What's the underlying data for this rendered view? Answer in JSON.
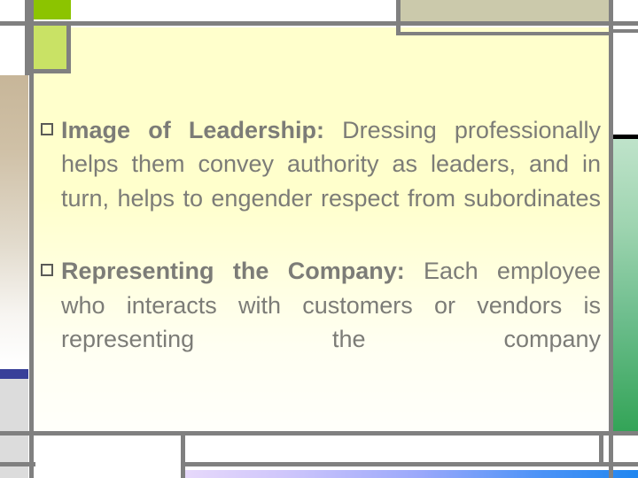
{
  "slide": {
    "background_color": "#ffffcc",
    "text_color": "#7c7c77",
    "accent_colors": {
      "green_tab": "#8cc400",
      "green_light": "#c9e265",
      "tan_block": "#cbc9ab",
      "tan_gradient": "#c7b699",
      "blue_bar": "#383f99",
      "gray_block": "#dcdcdc",
      "green_gradient": "#33a457",
      "rule_gray": "#808080",
      "black_line": "#000000"
    },
    "bullets": [
      {
        "marker": "hollow-square-bullet",
        "lead": "Image of Leadership:",
        "rest": " Dressing professionally helps them convey authority as leaders, and in turn, helps to engender respect from subordinates"
      },
      {
        "marker": "hollow-square-bullet",
        "lead": "Representing the Company:",
        "rest": " Each employee who interacts with customers or vendors is representing the company"
      }
    ]
  }
}
